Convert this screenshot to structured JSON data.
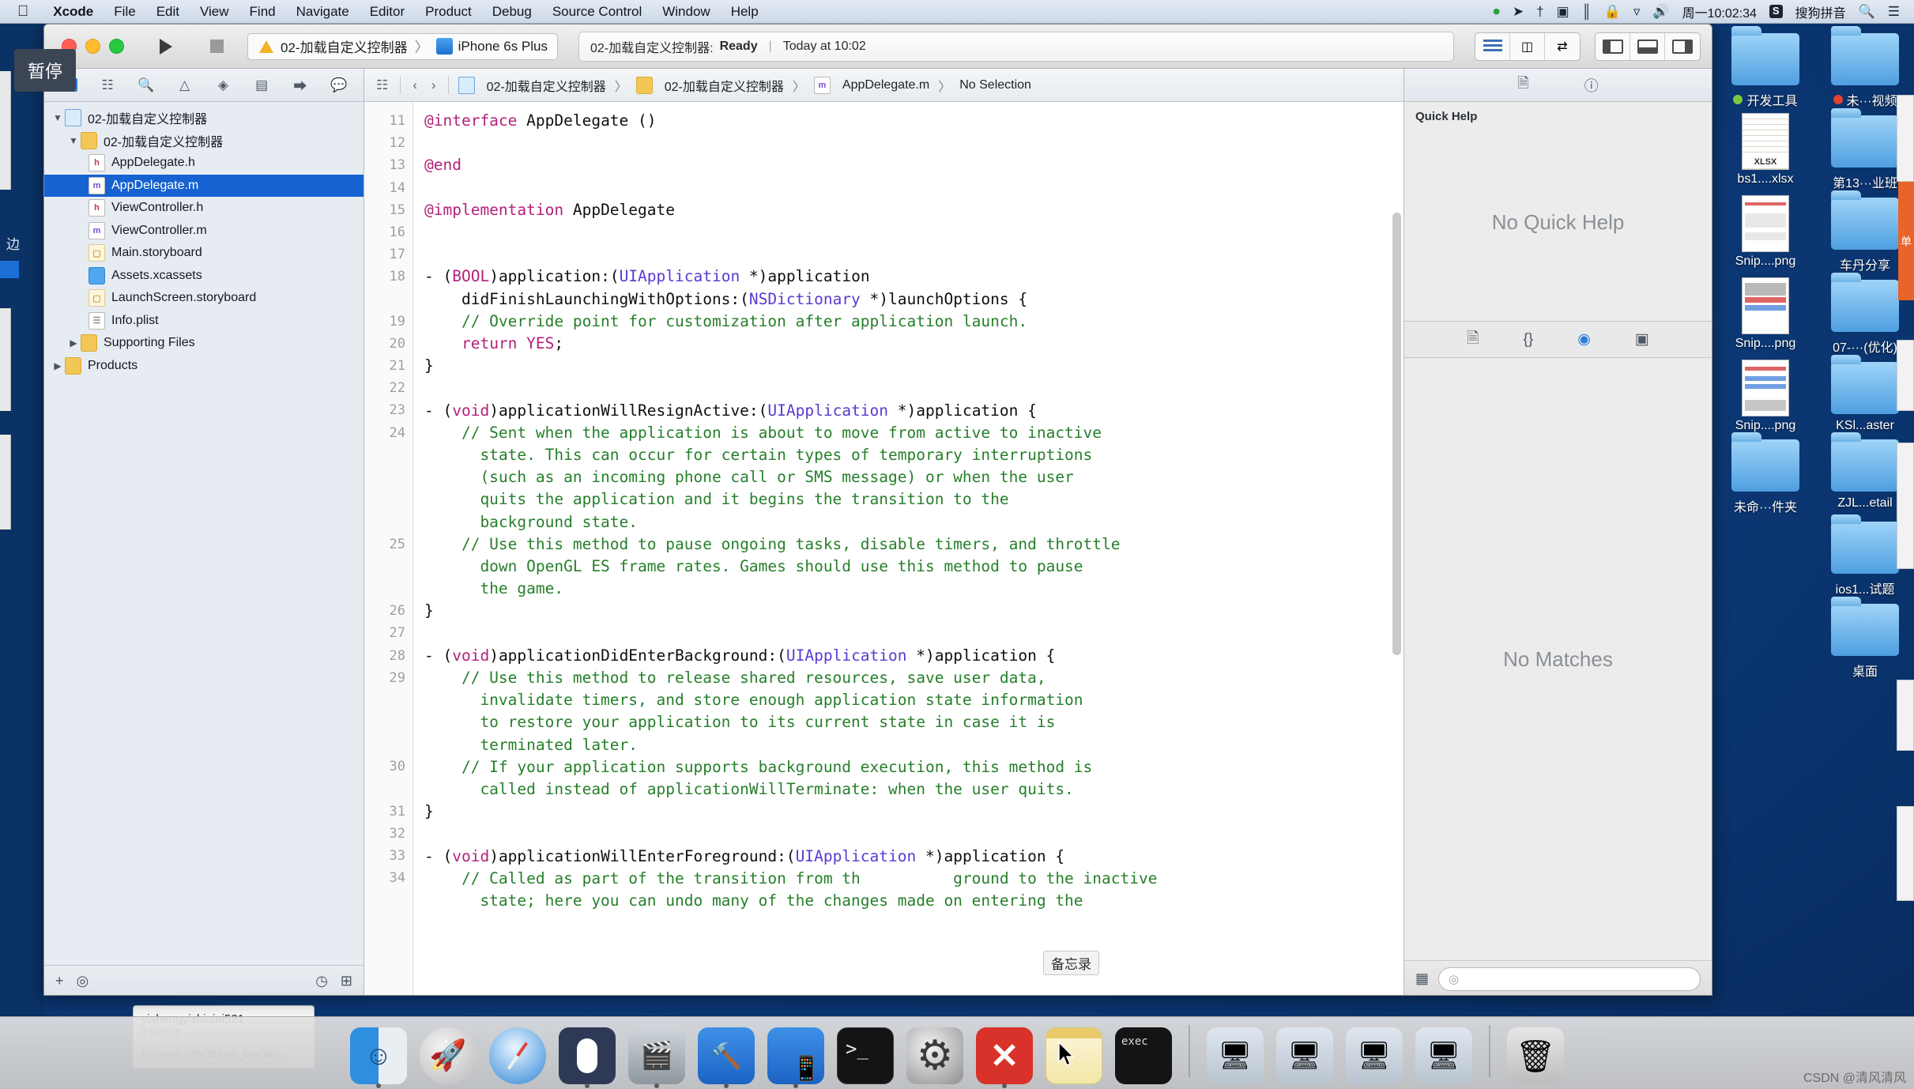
{
  "menubar": {
    "apple_icon": "apple-icon",
    "items": [
      {
        "label": "Xcode",
        "bold": true
      },
      {
        "label": "File",
        "bold": false
      },
      {
        "label": "Edit",
        "bold": false
      },
      {
        "label": "View",
        "bold": false
      },
      {
        "label": "Find",
        "bold": false
      },
      {
        "label": "Navigate",
        "bold": false
      },
      {
        "label": "Editor",
        "bold": false
      },
      {
        "label": "Product",
        "bold": false
      },
      {
        "label": "Debug",
        "bold": false
      },
      {
        "label": "Source Control",
        "bold": false
      },
      {
        "label": "Window",
        "bold": false
      },
      {
        "label": "Help",
        "bold": false
      }
    ],
    "status_icons": [
      "record-icon",
      "location-icon",
      "bluetooth-icon",
      "screen-record-icon",
      "audio-icon",
      "lock-icon",
      "wifi-icon",
      "volume-icon"
    ],
    "clock": "周一10:02:34",
    "ime_badge": "S",
    "ime_label": "搜狗拼音",
    "search_icon": "search-icon",
    "notification_icon": "list-icon"
  },
  "tooltip": {
    "text": "暂停"
  },
  "xcode": {
    "toolbar": {
      "run_icon": "play-icon",
      "stop_icon": "stop-icon",
      "scheme_name": "02-加载自定义控制器",
      "scheme_separator": "〉",
      "destination": "iPhone 6s Plus",
      "status_project": "02-加载自定义控制器:",
      "status_state": "Ready",
      "status_divider": "|",
      "status_time": "Today at 10:02",
      "editor_modes": [
        "standard-editor-icon",
        "assistant-editor-icon",
        "version-editor-icon"
      ],
      "panel_toggles": [
        "navigator-toggle-icon",
        "debug-toggle-icon",
        "utilities-toggle-icon"
      ]
    },
    "navigator": {
      "tabs": [
        "project-navigator-icon",
        "symbol-navigator-icon",
        "find-navigator-icon",
        "issue-navigator-icon",
        "test-navigator-icon",
        "debug-navigator-icon",
        "breakpoint-navigator-icon",
        "report-navigator-icon"
      ],
      "tree": [
        {
          "label": "02-加载自定义控制器",
          "indent": 0,
          "icon": "project",
          "twisty": "▼",
          "selected": false
        },
        {
          "label": "02-加载自定义控制器",
          "indent": 1,
          "icon": "folder",
          "twisty": "▼",
          "selected": false
        },
        {
          "label": "AppDelegate.h",
          "indent": 2,
          "icon": "h",
          "twisty": "",
          "selected": false
        },
        {
          "label": "AppDelegate.m",
          "indent": 2,
          "icon": "m",
          "twisty": "",
          "selected": true
        },
        {
          "label": "ViewController.h",
          "indent": 2,
          "icon": "h",
          "twisty": "",
          "selected": false
        },
        {
          "label": "ViewController.m",
          "indent": 2,
          "icon": "m",
          "twisty": "",
          "selected": false
        },
        {
          "label": "Main.storyboard",
          "indent": 2,
          "icon": "sb",
          "twisty": "",
          "selected": false
        },
        {
          "label": "Assets.xcassets",
          "indent": 2,
          "icon": "blue",
          "twisty": "",
          "selected": false
        },
        {
          "label": "LaunchScreen.storyboard",
          "indent": 2,
          "icon": "sb",
          "twisty": "",
          "selected": false
        },
        {
          "label": "Info.plist",
          "indent": 2,
          "icon": "pl",
          "twisty": "",
          "selected": false
        },
        {
          "label": "Supporting Files",
          "indent": 1,
          "icon": "folder",
          "twisty": "▶",
          "selected": false
        },
        {
          "label": "Products",
          "indent": 0,
          "icon": "folder",
          "twisty": "▶",
          "selected": false
        }
      ],
      "footer_icons": [
        "add-icon",
        "filter-icon",
        "recent-icon",
        "source-control-icon"
      ]
    },
    "jumpbar": {
      "left_icons": [
        "related-items-icon",
        "back-arrow-icon",
        "forward-arrow-icon"
      ],
      "crumbs": [
        {
          "label": "02-加载自定义控制器",
          "icon": "project"
        },
        {
          "label": "02-加载自定义控制器",
          "icon": "folder"
        },
        {
          "label": "AppDelegate.m",
          "icon": "m"
        },
        {
          "label": "No Selection",
          "icon": ""
        }
      ],
      "separator": "〉"
    },
    "code": {
      "first_line_number": 11,
      "lines": [
        {
          "n": "11",
          "segments": [
            {
              "t": "@interface",
              "c": "kw"
            },
            {
              "t": " AppDelegate ()",
              "c": "pl"
            }
          ]
        },
        {
          "n": "12",
          "segments": []
        },
        {
          "n": "13",
          "segments": [
            {
              "t": "@end",
              "c": "kw"
            }
          ]
        },
        {
          "n": "14",
          "segments": []
        },
        {
          "n": "15",
          "segments": [
            {
              "t": "@implementation",
              "c": "kw"
            },
            {
              "t": " AppDelegate",
              "c": "pl"
            }
          ]
        },
        {
          "n": "16",
          "segments": []
        },
        {
          "n": "17",
          "segments": []
        },
        {
          "n": "18",
          "segments": [
            {
              "t": "- (",
              "c": "pl"
            },
            {
              "t": "BOOL",
              "c": "kw"
            },
            {
              "t": ")application:(",
              "c": "pl"
            },
            {
              "t": "UIApplication",
              "c": "ty"
            },
            {
              "t": " *)application",
              "c": "pl"
            }
          ]
        },
        {
          "n": "",
          "segments": [
            {
              "t": "    didFinishLaunchingWithOptions:(",
              "c": "pl"
            },
            {
              "t": "NSDictionary",
              "c": "ty"
            },
            {
              "t": " *)launchOptions {",
              "c": "pl"
            }
          ]
        },
        {
          "n": "19",
          "segments": [
            {
              "t": "    // Override point for customization after application launch.",
              "c": "cm"
            }
          ]
        },
        {
          "n": "20",
          "segments": [
            {
              "t": "    ",
              "c": "pl"
            },
            {
              "t": "return",
              "c": "kw"
            },
            {
              "t": " ",
              "c": "pl"
            },
            {
              "t": "YES",
              "c": "kw"
            },
            {
              "t": ";",
              "c": "pl"
            }
          ]
        },
        {
          "n": "21",
          "segments": [
            {
              "t": "}",
              "c": "pl"
            }
          ]
        },
        {
          "n": "22",
          "segments": []
        },
        {
          "n": "23",
          "segments": [
            {
              "t": "- (",
              "c": "pl"
            },
            {
              "t": "void",
              "c": "kw"
            },
            {
              "t": ")applicationWillResignActive:(",
              "c": "pl"
            },
            {
              "t": "UIApplication",
              "c": "ty"
            },
            {
              "t": " *)application {",
              "c": "pl"
            }
          ]
        },
        {
          "n": "24",
          "segments": [
            {
              "t": "    // Sent when the application is about to move from active to inactive",
              "c": "cm"
            }
          ]
        },
        {
          "n": "",
          "segments": [
            {
              "t": "      state. This can occur for certain types of temporary interruptions",
              "c": "cm"
            }
          ]
        },
        {
          "n": "",
          "segments": [
            {
              "t": "      (such as an incoming phone call or SMS message) or when the user",
              "c": "cm"
            }
          ]
        },
        {
          "n": "",
          "segments": [
            {
              "t": "      quits the application and it begins the transition to the",
              "c": "cm"
            }
          ]
        },
        {
          "n": "",
          "segments": [
            {
              "t": "      background state.",
              "c": "cm"
            }
          ]
        },
        {
          "n": "25",
          "segments": [
            {
              "t": "    // Use this method to pause ongoing tasks, disable timers, and throttle",
              "c": "cm"
            }
          ]
        },
        {
          "n": "",
          "segments": [
            {
              "t": "      down OpenGL ES frame rates. Games should use this method to pause",
              "c": "cm"
            }
          ]
        },
        {
          "n": "",
          "segments": [
            {
              "t": "      the game.",
              "c": "cm"
            }
          ]
        },
        {
          "n": "26",
          "segments": [
            {
              "t": "}",
              "c": "pl"
            }
          ]
        },
        {
          "n": "27",
          "segments": []
        },
        {
          "n": "28",
          "segments": [
            {
              "t": "- (",
              "c": "pl"
            },
            {
              "t": "void",
              "c": "kw"
            },
            {
              "t": ")applicationDidEnterBackground:(",
              "c": "pl"
            },
            {
              "t": "UIApplication",
              "c": "ty"
            },
            {
              "t": " *)application {",
              "c": "pl"
            }
          ]
        },
        {
          "n": "29",
          "segments": [
            {
              "t": "    // Use this method to release shared resources, save user data,",
              "c": "cm"
            }
          ]
        },
        {
          "n": "",
          "segments": [
            {
              "t": "      invalidate timers, and store enough application state information",
              "c": "cm"
            }
          ]
        },
        {
          "n": "",
          "segments": [
            {
              "t": "      to restore your application to its current state in case it is",
              "c": "cm"
            }
          ]
        },
        {
          "n": "",
          "segments": [
            {
              "t": "      terminated later.",
              "c": "cm"
            }
          ]
        },
        {
          "n": "30",
          "segments": [
            {
              "t": "    // If your application supports background execution, this method is",
              "c": "cm"
            }
          ]
        },
        {
          "n": "",
          "segments": [
            {
              "t": "      called instead of applicationWillTerminate: when the user quits.",
              "c": "cm"
            }
          ]
        },
        {
          "n": "31",
          "segments": [
            {
              "t": "}",
              "c": "pl"
            }
          ]
        },
        {
          "n": "32",
          "segments": []
        },
        {
          "n": "33",
          "segments": [
            {
              "t": "- (",
              "c": "pl"
            },
            {
              "t": "void",
              "c": "kw"
            },
            {
              "t": ")applicationWillEnterForeground:(",
              "c": "pl"
            },
            {
              "t": "UIApplication",
              "c": "ty"
            },
            {
              "t": " *)application {",
              "c": "pl"
            }
          ]
        },
        {
          "n": "34",
          "segments": [
            {
              "t": "    // Called as part of the transition from th          ground to the inactive",
              "c": "cm"
            }
          ]
        },
        {
          "n": "",
          "segments": [
            {
              "t": "      state; here you can undo many of the changes made on entering the",
              "c": "cm"
            }
          ]
        }
      ]
    },
    "utilities": {
      "tabs": [
        "file-inspector-icon",
        "quick-help-inspector-icon"
      ],
      "quick_help_title": "Quick Help",
      "quick_help_empty": "No Quick Help",
      "library_tabs": [
        "file-template-library-icon",
        "code-snippet-library-icon",
        "object-library-icon",
        "media-library-icon"
      ],
      "library_empty": "No Matches",
      "library_filter_icons": [
        "grid-view-icon"
      ],
      "library_search_placeholder": ""
    }
  },
  "memo_tooltip": {
    "text": "备忘录"
  },
  "memo_window": {
    "title": "yishengyishiaini521",
    "date": "15/8/18",
    "body": "/s?ie=utf-8&f=38&rsv_bp=0&rs"
  },
  "desktop": {
    "icons": [
      {
        "label": "开发工具",
        "type": "folder",
        "tag": "green"
      },
      {
        "label": "未···视频",
        "type": "folder",
        "tag": "red"
      },
      {
        "label": "bs1....xlsx",
        "type": "xlsx",
        "tag": ""
      },
      {
        "label": "第13···业班",
        "type": "folder",
        "tag": ""
      },
      {
        "label": "Snip....png",
        "type": "png",
        "tag": ""
      },
      {
        "label": "车丹分享",
        "type": "folder",
        "tag": ""
      },
      {
        "label": "Snip....png",
        "type": "png",
        "tag": ""
      },
      {
        "label": "07-···(优化)",
        "type": "folder",
        "tag": ""
      },
      {
        "label": "Snip....png",
        "type": "png",
        "tag": ""
      },
      {
        "label": "KSl...aster",
        "type": "folder",
        "tag": ""
      },
      {
        "label": "未命···件夹",
        "type": "folder",
        "tag": ""
      },
      {
        "label": "ZJL...etail",
        "type": "folder",
        "tag": ""
      },
      {
        "label": "",
        "type": "none",
        "tag": ""
      },
      {
        "label": "ios1...试题",
        "type": "folder",
        "tag": ""
      },
      {
        "label": "",
        "type": "none",
        "tag": ""
      },
      {
        "label": "桌面",
        "type": "folder",
        "tag": ""
      }
    ],
    "right_tab_label": "单",
    "left_edge_label": "边"
  },
  "dock": {
    "items": [
      {
        "name": "finder",
        "cls": "ic-finder",
        "running": true
      },
      {
        "name": "launchpad",
        "cls": "ic-launchpad",
        "running": false
      },
      {
        "name": "safari",
        "cls": "ic-safari",
        "running": false
      },
      {
        "name": "mouse-app",
        "cls": "ic-mouse",
        "running": true
      },
      {
        "name": "quicktime",
        "cls": "ic-qt",
        "running": true
      },
      {
        "name": "xcode",
        "cls": "ic-xcode",
        "running": true
      },
      {
        "name": "xcode-simulator",
        "cls": "ic-xcodeb",
        "running": true
      },
      {
        "name": "terminal",
        "cls": "ic-term",
        "running": false
      },
      {
        "name": "system-preferences",
        "cls": "ic-prefs",
        "running": false
      },
      {
        "name": "xmind",
        "cls": "ic-x",
        "running": true
      },
      {
        "name": "notes",
        "cls": "ic-notes",
        "running": false
      },
      {
        "name": "terminal-exec",
        "cls": "ic-term2",
        "running": false
      },
      {
        "name": "window-1",
        "cls": "ic-win",
        "running": false
      },
      {
        "name": "window-2",
        "cls": "ic-win",
        "running": false
      },
      {
        "name": "window-3",
        "cls": "ic-win",
        "running": false
      },
      {
        "name": "window-4",
        "cls": "ic-win",
        "running": false
      },
      {
        "name": "trash",
        "cls": "ic-trash",
        "running": false
      }
    ]
  },
  "watermark": {
    "text": "CSDN @清风清风"
  },
  "colors": {
    "selection_blue": "#1562d0",
    "keyword": "#b3217b",
    "type": "#5a3ad1",
    "comment": "#267f2a",
    "desktop": "#0d3d7f"
  }
}
